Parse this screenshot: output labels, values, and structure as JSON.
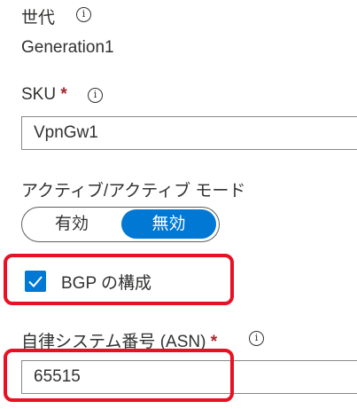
{
  "generation": {
    "label": "世代",
    "value": "Generation1",
    "info_icon": "info-icon"
  },
  "sku": {
    "label": "SKU",
    "required_mark": "*",
    "value": "VpnGw1",
    "info_icon": "info-icon"
  },
  "active_active": {
    "label": "アクティブ/アクティブ モード",
    "options": [
      "有効",
      "無効"
    ],
    "selected": "無効"
  },
  "bgp": {
    "label": "BGP の構成",
    "checked": true,
    "check_icon": "checkmark-icon"
  },
  "asn": {
    "label": "自律システム番号 (ASN)",
    "required_mark": "*",
    "value": "65515",
    "info_icon": "info-icon"
  },
  "colors": {
    "accent": "#0078d4",
    "highlight": "#e81123",
    "required": "#a4262c"
  }
}
